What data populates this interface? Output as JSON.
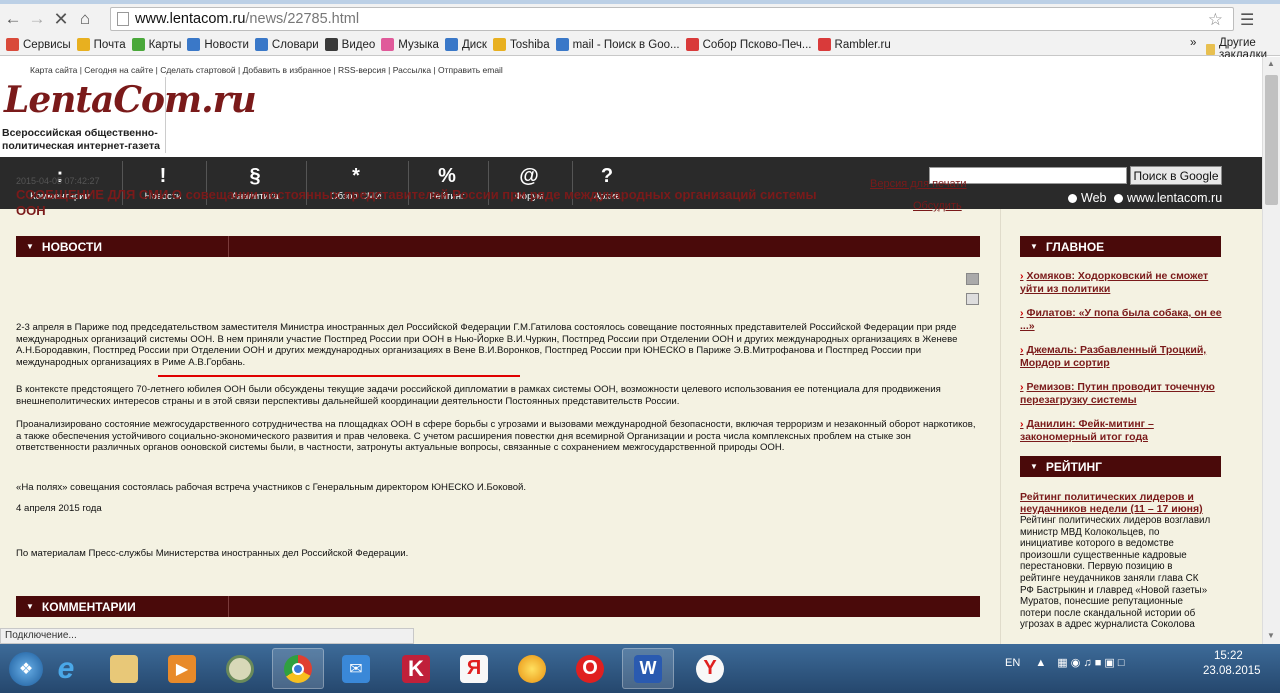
{
  "browser": {
    "url_domain": "www.lentacom.ru",
    "url_path": "/news/22785.html",
    "bookmarks": [
      {
        "label": "Сервисы",
        "color": "#d94a3a"
      },
      {
        "label": "Почта",
        "color": "#e8b020"
      },
      {
        "label": "Карты",
        "color": "#4aa83a"
      },
      {
        "label": "Новости",
        "color": "#3a78c8"
      },
      {
        "label": "Словари",
        "color": "#3a78c8"
      },
      {
        "label": "Видео",
        "color": "#3a3a3a"
      },
      {
        "label": "Музыка",
        "color": "#e05a9a"
      },
      {
        "label": "Диск",
        "color": "#3a78c8"
      },
      {
        "label": "Toshiba",
        "color": "#e8b020"
      },
      {
        "label": "mail - Поиск в Goo...",
        "color": "#3a78c8"
      },
      {
        "label": "Собор Псково-Печ...",
        "color": "#d93a3a"
      },
      {
        "label": "Rambler.ru",
        "color": "#d93a3a"
      }
    ],
    "more_label": "»",
    "other_bookmarks": "Другие закладки",
    "status": "Подключение..."
  },
  "site": {
    "top_links": "Карта сайта  |  Сегодня на сайте  |  Сделать стартовой  |  Добавить в избранное  |  RSS-версия  |  Рассылка  |  Отправить email",
    "logo": "LentaCom.ru",
    "tagline_1": "Всероссийская общественно-",
    "tagline_2": "политическая интернет-газета",
    "nav": [
      {
        "glyph": ":",
        "label": "Комментарии"
      },
      {
        "glyph": "!",
        "label": "Новости"
      },
      {
        "glyph": "§",
        "label": "Аналитика"
      },
      {
        "glyph": "*",
        "label": "Обзор СМИ"
      },
      {
        "glyph": "%",
        "label": "Рейтинг"
      },
      {
        "glyph": "@",
        "label": "Форум"
      },
      {
        "glyph": "?",
        "label": "Архив"
      }
    ],
    "search_button": "Поиск в Google",
    "radio_web": "Web",
    "radio_site": "www.lentacom.ru"
  },
  "article": {
    "section": "НОВОСТИ",
    "date": "2015-04-05 07:42:27",
    "title": "СООБЩЕНИЕ ДЛЯ СМИ О совещании постоянных представителей России при ряде международных организаций системы ООН",
    "print_link": "Версия для печати",
    "discuss_link": "Обсудить",
    "p1": "2-3 апреля в Париже под председательством заместителя Министра иностранных дел Российской Федерации Г.М.Гатилова состоялось совещание постоянных представителей Российской Федерации при ряде международных организаций системы ООН. В нем приняли участие Постпред России при ООН в Нью-Йорке В.И.Чуркин, Постпред России при Отделении ООН и других международных организациях в Женеве А.Н.Бородавкин, Постпред России при Отделении ООН и других международных организациях в Вене В.И.Воронков, Постпред России при ЮНЕСКО в Париже Э.В.Митрофанова и Постпред России при международных организациях в Риме А.В.Горбань.",
    "p2": "В контексте предстоящего 70-летнего юбилея ООН были обсуждены текущие задачи российской дипломатии в рамках системы ООН, возможности целевого использования ее потенциала для продвижения внешнеполитических интересов страны и в этой связи перспективы дальнейшей координации деятельности Постоянных представительств России.",
    "p3": "Проанализировано состояние межгосударственного сотрудничества на площадках ООН в сфере борьбы с угрозами и вызовами международной безопасности, включая терроризм и незаконный оборот наркотиков, а также обеспечения устойчивого социально-экономического развития и прав человека. С учетом расширения повестки дня всемирной Организации и роста числа комплексных проблем на стыке зон ответственности различных органов ооновской системы были, в частности, затронуты актуальные вопросы, связанные с сохранением межгосударственной природы ООН.",
    "p4": "«На полях» совещания состоялась рабочая встреча участников с Генеральным директором ЮНЕСКО И.Боковой.",
    "p5": "4 апреля 2015 года",
    "p6": "По материалам Пресс-службы Министерства иностранных дел Российской Федерации.",
    "comments_section": "КОММЕНТАРИИ"
  },
  "sidebar": {
    "main_section": "ГЛАВНОЕ",
    "links": [
      "Хомяков: Ходорковский не сможет уйти из политики",
      "Филатов: «У попа была собака, он ее ...»",
      "Джемаль: Разбавленный Троцкий, Мордор и сортир",
      "Ремизов: Путин проводит точечную перезагрузку системы",
      "Данилин: Фейк-митинг – закономерный итог года"
    ],
    "rating_section": "РЕЙТИНГ",
    "rating_title": "Рейтинг политических лидеров и неудачников недели (11 – 17 июня)",
    "rating_text": "Рейтинг политических лидеров возглавил министр МВД Колокольцев, по инициативе которого в ведомстве произошли существенные кадровые перестановки. Первую позицию в рейтинге неудачников заняли глава СК РФ Бастрыкин и главред «Новой газеты» Муратов, понесшие репутационные потери после скандальной истории об угрозах в адрес журналиста Соколова"
  },
  "taskbar": {
    "lang": "EN",
    "time": "15:22",
    "date": "23.08.2015"
  }
}
